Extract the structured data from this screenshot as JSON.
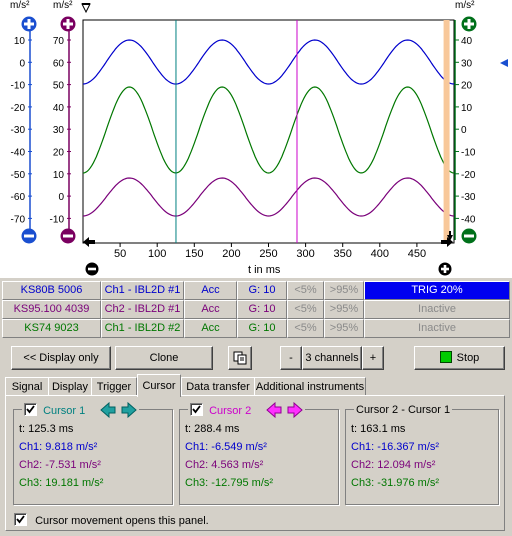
{
  "plot": {
    "unit_left_outer": "m/s²",
    "unit_left_inner": "m/s²",
    "unit_right": "m/s²",
    "axis_outer_ticks": [
      "10",
      "0",
      "-10",
      "-20",
      "-30",
      "-40",
      "-50",
      "-60",
      "-70"
    ],
    "axis_inner_ticks": [
      "70",
      "60",
      "50",
      "40",
      "30",
      "20",
      "10",
      "0",
      "-10"
    ],
    "axis_right_ticks": [
      "40",
      "30",
      "20",
      "10",
      "0",
      "-10",
      "-20",
      "-30",
      "-40"
    ],
    "x_ticks": [
      "50",
      "100",
      "150",
      "200",
      "250",
      "300",
      "350",
      "400",
      "450"
    ],
    "x_label": "t in ms",
    "colors": {
      "ch1": "#0000cc",
      "ch2": "#007700",
      "ch3": "#7a007a",
      "cursor1": "#008080",
      "cursor2": "#cc00cc",
      "trigger": "#f8c89a"
    }
  },
  "chart_data": {
    "type": "line",
    "x_range": [
      0,
      500
    ],
    "series": [
      {
        "name": "Ch1 - IBL2D #1",
        "color": "#0000cc",
        "offset": 0,
        "amplitude": 10,
        "period_ms": 125,
        "axis": "left-outer"
      },
      {
        "name": "Ch2 - IBL2D #1",
        "color": "#007700",
        "offset": 0,
        "amplitude": 30,
        "period_ms": 125,
        "axis": "right"
      },
      {
        "name": "Ch1 - IBL2D #2",
        "color": "#7a007a",
        "offset": 0,
        "amplitude": 10,
        "period_ms": 125,
        "axis": "left-inner"
      }
    ],
    "cursor1_t": 125.3,
    "cursor2_t": 288.4
  },
  "channels": [
    {
      "sensor": "KS80B 5006",
      "name": "Ch1 - IBL2D #1",
      "mode": "Acc",
      "gain": "G: 10",
      "lo": "<5%",
      "hi": ">95%",
      "status": "TRIG  20%",
      "color": "#0000cc",
      "active": true
    },
    {
      "sensor": "KS95.100 4039",
      "name": "Ch2 - IBL2D #1",
      "mode": "Acc",
      "gain": "G: 10",
      "lo": "<5%",
      "hi": ">95%",
      "status": "Inactive",
      "color": "#7a007a",
      "active": false
    },
    {
      "sensor": "KS74 9023",
      "name": "Ch1 - IBL2D #2",
      "mode": "Acc",
      "gain": "G: 10",
      "lo": "<5%",
      "hi": ">95%",
      "status": "Inactive",
      "color": "#007700",
      "active": false
    }
  ],
  "toolbar": {
    "display_only": "<< Display only",
    "clone": "Clone",
    "minus": "-",
    "channels": "3 channels",
    "plus": "+",
    "stop": "Stop"
  },
  "tabs": [
    "Signal",
    "Display",
    "Trigger",
    "Cursor",
    "Data transfer",
    "Additional instruments"
  ],
  "cursor1": {
    "title": "Cursor 1",
    "t": "t: 125.3 ms",
    "ch1": "Ch1: 9.818 m/s²",
    "ch2": "Ch2: -7.531 m/s²",
    "ch3": "Ch3: 19.181 m/s²"
  },
  "cursor2": {
    "title": "Cursor 2",
    "t": "t: 288.4 ms",
    "ch1": "Ch1: -6.549 m/s²",
    "ch2": "Ch2: 4.563 m/s²",
    "ch3": "Ch3: -12.795 m/s²"
  },
  "diff": {
    "title": "Cursor 2 - Cursor 1",
    "t": "t: 163.1 ms",
    "ch1": "Ch1: -16.367 m/s²",
    "ch2": "Ch2: 12.094 m/s²",
    "ch3": "Ch3: -31.976 m/s²"
  },
  "footer_checkbox": "Cursor movement opens this panel."
}
